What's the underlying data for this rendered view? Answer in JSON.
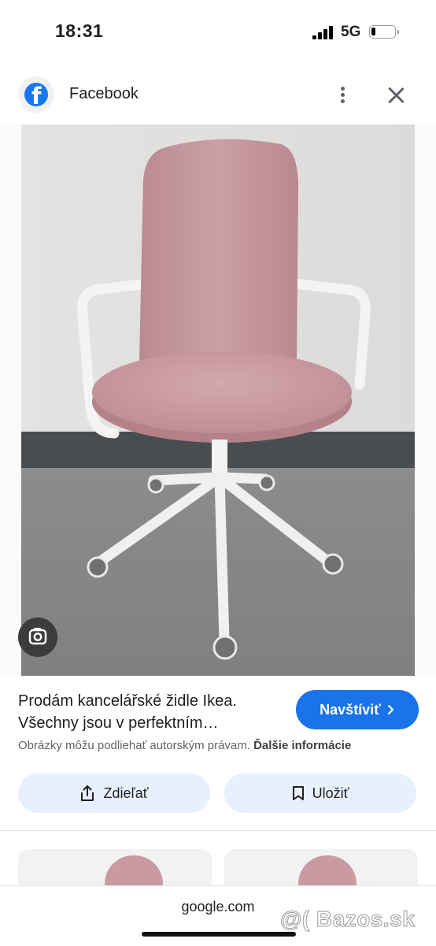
{
  "status_bar": {
    "time": "18:31",
    "network": "5G",
    "battery_level": 0.2
  },
  "header": {
    "title": "Facebook",
    "logo_icon": "facebook-icon",
    "menu_icon": "more-vert-icon",
    "close_icon": "close-icon"
  },
  "image": {
    "lens_icon": "google-lens-icon"
  },
  "result": {
    "title_line1": "Prodám kancelářské židle Ikea.",
    "title_line2": "Všechny jsou v perfektním…",
    "visit_label": "Navštíviť",
    "copyright_text": "Obrázky môžu podliehať autorským právam.",
    "more_info_label": "Ďalšie informácie"
  },
  "actions": {
    "share_label": "Zdieľať",
    "save_label": "Uložiť"
  },
  "bottom_bar": {
    "url": "google.com",
    "watermark": "@( Bazos.sk"
  },
  "colors": {
    "accent": "#1a73e8",
    "chip_bg": "#e8f0fe",
    "facebook_blue": "#1877f2",
    "chair_pink": "#c99aa2"
  }
}
